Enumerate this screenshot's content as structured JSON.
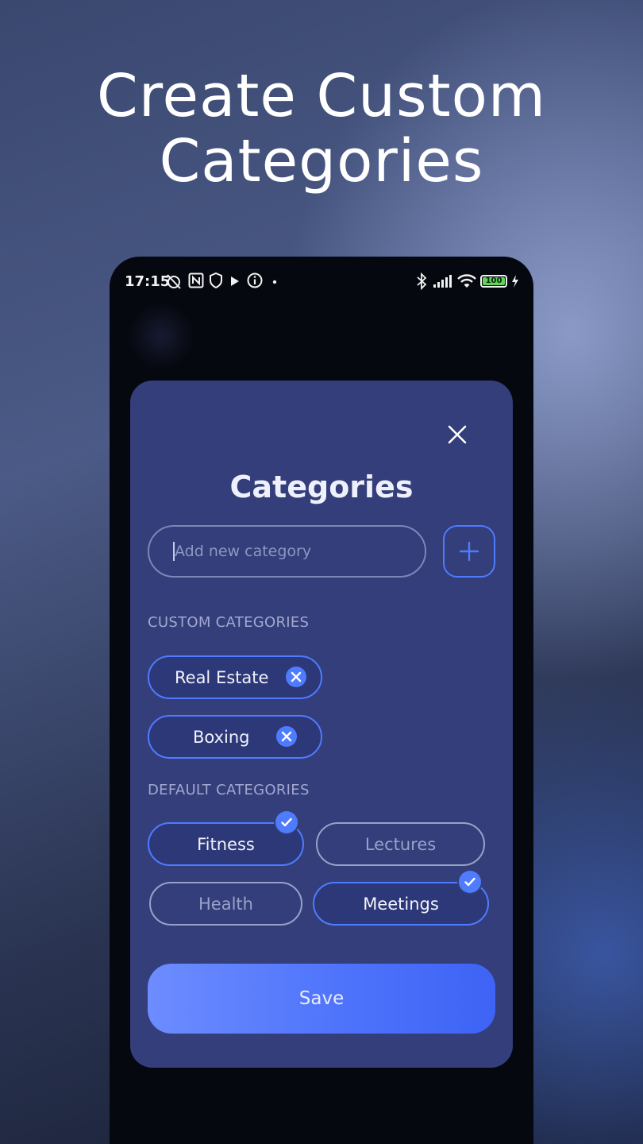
{
  "headline": {
    "line1": "Create Custom",
    "line2": "Categories"
  },
  "status_bar": {
    "time": "17:15",
    "battery": "100",
    "left_icons": [
      "alarm-off-icon",
      "nfc-icon",
      "shield-icon",
      "play-icon",
      "info-icon",
      "dot-icon"
    ],
    "right_icons": [
      "bluetooth-icon",
      "signal-icon",
      "wifi-icon",
      "battery-icon",
      "charging-icon"
    ]
  },
  "dialog": {
    "title": "Categories",
    "close_icon": "close-icon",
    "input_placeholder": "Add new category",
    "add_icon": "plus-icon",
    "custom_section_label": "CUSTOM CATEGORIES",
    "custom_categories": [
      {
        "label": "Real Estate",
        "removable": true
      },
      {
        "label": "Boxing",
        "removable": true
      }
    ],
    "default_section_label": "DEFAULT CATEGORIES",
    "default_categories": [
      {
        "label": "Fitness",
        "selected": true
      },
      {
        "label": "Lectures",
        "selected": false
      },
      {
        "label": "Health",
        "selected": false
      },
      {
        "label": "Meetings",
        "selected": true
      }
    ],
    "save_label": "Save"
  },
  "colors": {
    "accent": "#4f7bff",
    "dialog_bg": "#333e7a",
    "phone_bg": "#06080f",
    "save_gradient_start": "#6d8cff",
    "save_gradient_end": "#3e63f5"
  }
}
